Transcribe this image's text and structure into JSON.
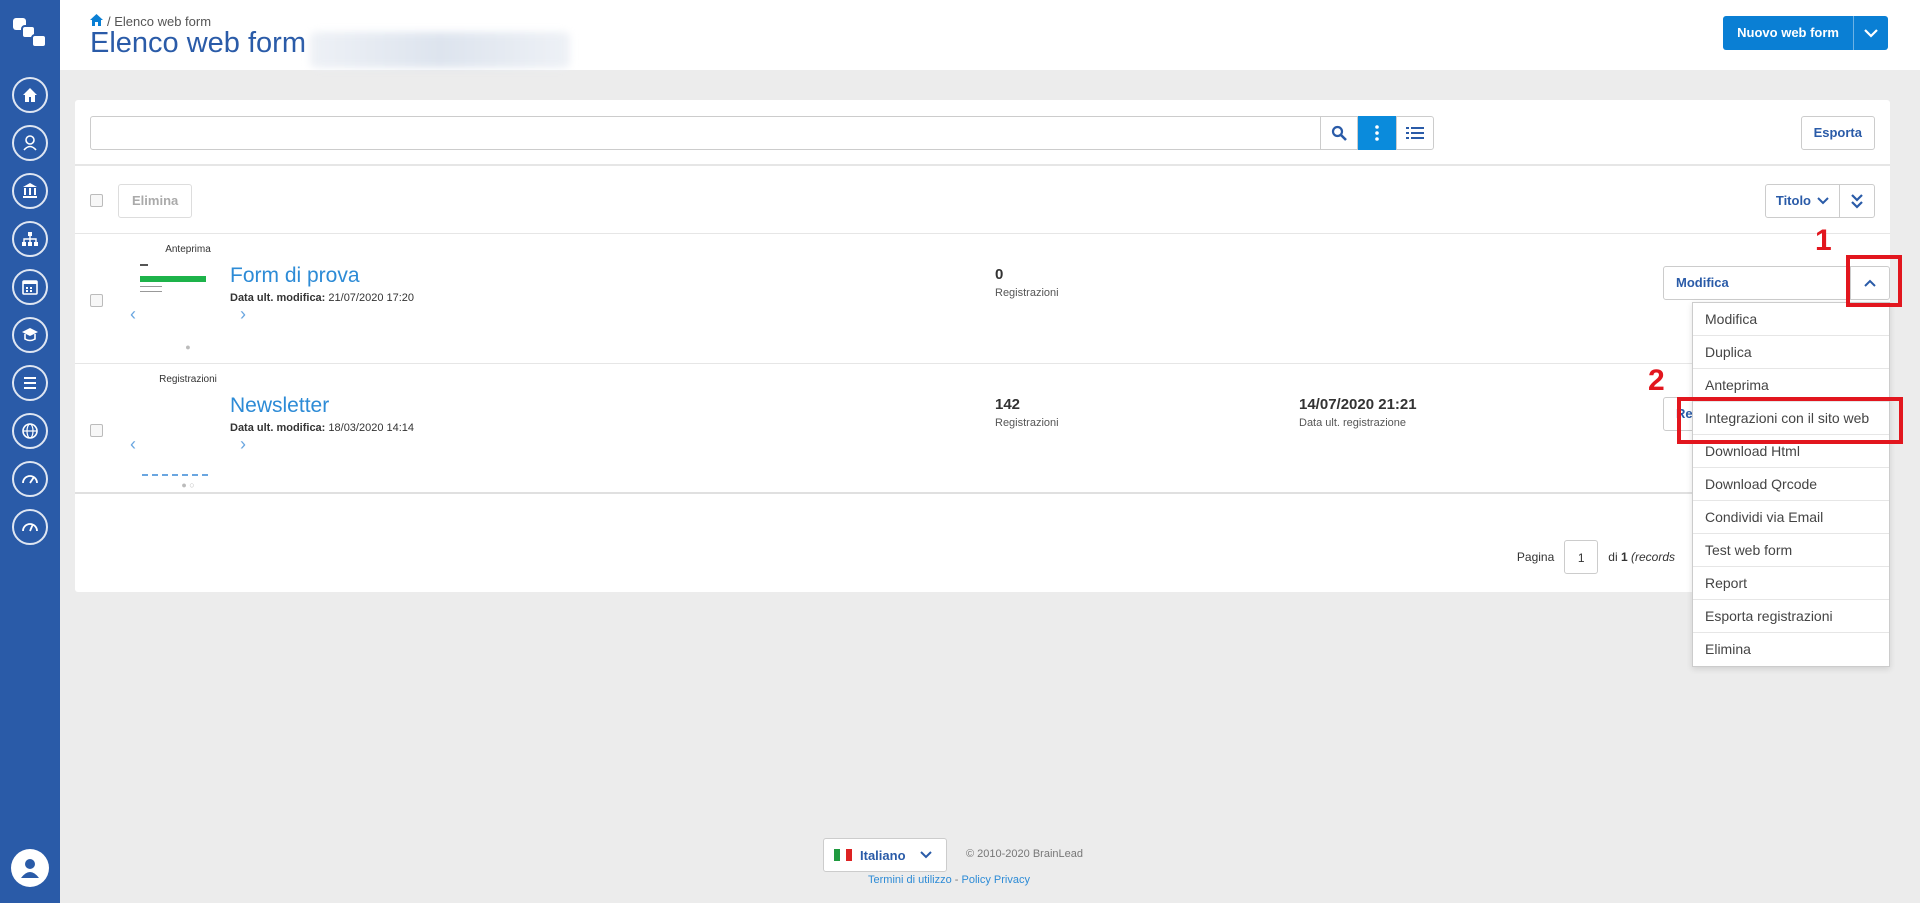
{
  "header": {
    "breadcrumb": "/ Elenco web form",
    "title": "Elenco web form",
    "new_button": "Nuovo web form"
  },
  "toolbar": {
    "search_value": "",
    "export_label": "Esporta"
  },
  "actions": {
    "delete_label": "Elimina",
    "sort_label": "Titolo"
  },
  "rows": [
    {
      "thumb_label": "Anteprima",
      "title": "Form di prova",
      "meta_label": "Data ult. modifica:",
      "meta_value": " 21/07/2020 17:20",
      "count": "0",
      "count_label": "Registrazioni",
      "action": "Modifica"
    },
    {
      "thumb_label": "Registrazioni",
      "title": "Newsletter",
      "meta_label": "Data ult. modifica:",
      "meta_value": " 18/03/2020 14:14",
      "count": "142",
      "count_label": "Registrazioni",
      "last_reg": "14/07/2020 21:21",
      "last_reg_label": "Data ult. registrazione",
      "action": "Re"
    }
  ],
  "pagination": {
    "label": "Pagina",
    "current": "1",
    "of": "di",
    "total": "1",
    "records": "(records"
  },
  "dropdown": [
    "Modifica",
    "Duplica",
    "Anteprima",
    "Integrazioni con il sito web",
    "Download Html",
    "Download Qrcode",
    "Condividi via Email",
    "Test web form",
    "Report",
    "Esporta registrazioni",
    "Elimina"
  ],
  "annotations": {
    "marker1": "1",
    "marker2": "2"
  },
  "footer": {
    "language": "Italiano",
    "copyright": "© 2010-2020 BrainLead",
    "terms": "Termini di utilizzo",
    "separator": " - ",
    "privacy": "Policy Privacy"
  },
  "colors": {
    "sidebar": "#2a5ba8",
    "primary": "#0a7fd4",
    "link": "#2d8bd6",
    "highlight": "#e2161e"
  }
}
